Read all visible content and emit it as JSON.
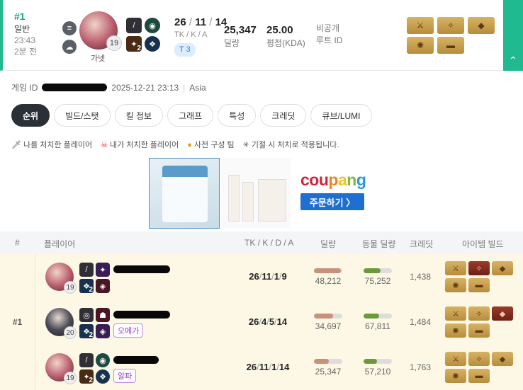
{
  "match": {
    "rank": "#1",
    "mode": "일반",
    "time": "23:43",
    "ago": "2분 전",
    "character": "가넷",
    "level": "19",
    "kda": {
      "tk": "26",
      "k": "11",
      "a": "14"
    },
    "kda_label": "TK / K / A",
    "tier": "T 3",
    "damage": "25,347",
    "damage_label": "딜량",
    "kda_score": "25.00",
    "kda_score_label": "평점(KDA)",
    "visibility": "비공개",
    "route_label": "루트 ID",
    "skill_badge": "2",
    "expand_icon": "chevron-up-icon"
  },
  "meta": {
    "game_id_label": "게임 ID",
    "datetime": "2025-12-21 23:13",
    "region": "Asia"
  },
  "tabs": [
    {
      "label": "순위",
      "active": true
    },
    {
      "label": "빌드/스탯"
    },
    {
      "label": "킬 정보"
    },
    {
      "label": "그래프"
    },
    {
      "label": "특성"
    },
    {
      "label": "크레딧"
    },
    {
      "label": "큐브/LUMI"
    }
  ],
  "legend": {
    "killed_me": "나를 처치한 플레이어",
    "i_killed": "내가 처치한 플레이어",
    "premade": "사전 구성 팀",
    "note": "기절 시 처치로 적용됩니다."
  },
  "ad": {
    "brand": [
      "cou",
      "p",
      "a",
      "n",
      "g"
    ],
    "button": "주문하기 〉"
  },
  "table": {
    "headers": {
      "num": "#",
      "player": "플레이어",
      "tkda": "TK / K / D / A",
      "damage": "딜량",
      "animal": "동물 딜량",
      "credit": "크레딧",
      "build": "아이템 빌드"
    },
    "team_rank": "#1",
    "rows": [
      {
        "level": "19",
        "tk": "26",
        "k": "11",
        "d": "1",
        "a": "9",
        "damage": "48,212",
        "animal": "75,252",
        "credit": "1,438",
        "tag": "",
        "skill_badge": "2",
        "damage_pct": 0.95,
        "animal_pct": 0.6
      },
      {
        "level": "20",
        "tk": "26",
        "k": "4",
        "d": "5",
        "a": "14",
        "damage": "34,697",
        "animal": "67,811",
        "credit": "1,484",
        "tag": "오메가",
        "skill_badge": "2",
        "damage_pct": 0.68,
        "animal_pct": 0.55
      },
      {
        "level": "19",
        "tk": "26",
        "k": "11",
        "d": "1",
        "a": "14",
        "damage": "25,347",
        "animal": "57,210",
        "credit": "1,763",
        "tag": "알파",
        "skill_badge": "2",
        "damage_pct": 0.52,
        "animal_pct": 0.47
      }
    ]
  }
}
